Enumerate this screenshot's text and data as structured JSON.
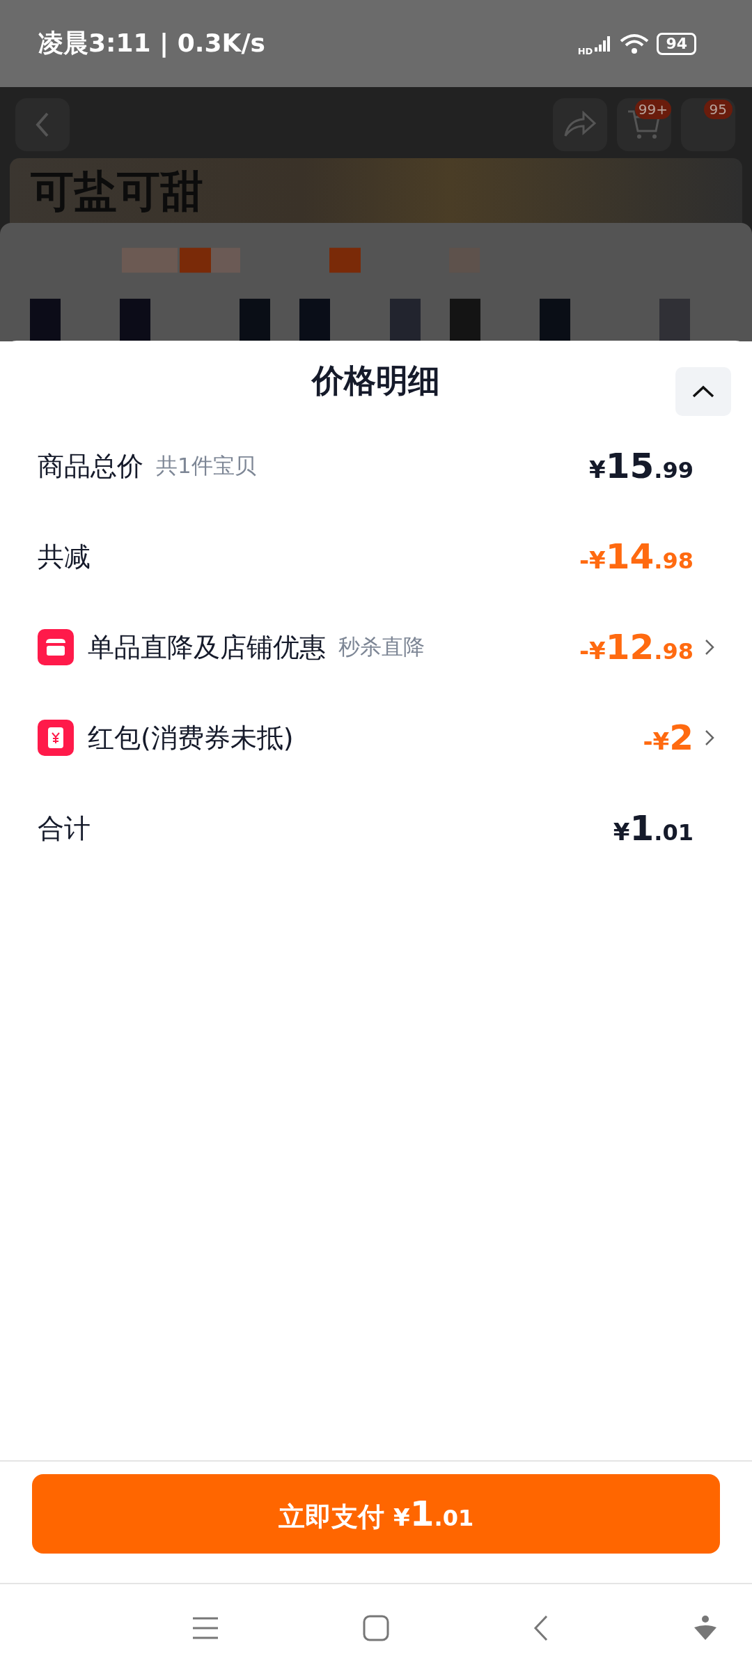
{
  "status_bar": {
    "time": "凌晨3:11 | 0.3K/s",
    "network_label": "HD",
    "battery": "94"
  },
  "background_page": {
    "cart_badge": "99+",
    "message_badge": "95",
    "banner_title": "可盐可甜"
  },
  "sheet": {
    "title": "价格明细",
    "rows": [
      {
        "kind": "plain",
        "label": "商品总价",
        "note": "共1件宝贝",
        "color": "#151a2a",
        "amount": {
          "prefix": "¥",
          "whole": "15",
          "fraction": ".99"
        },
        "has_detail": false
      },
      {
        "kind": "plain",
        "label": "共减",
        "color": "#ff6a10",
        "amount": {
          "prefix": "-¥",
          "whole": "14",
          "fraction": ".98"
        },
        "has_detail": false
      },
      {
        "kind": "shop",
        "label": "单品直降及店铺优惠",
        "note": "秒杀直降",
        "color": "#ff6a10",
        "amount": {
          "prefix": "-¥",
          "whole": "12",
          "fraction": ".98"
        },
        "has_detail": true
      },
      {
        "kind": "coupon",
        "label": "红包(消费券未抵)",
        "color": "#ff6a10",
        "amount": {
          "prefix": "-¥",
          "whole": "2"
        },
        "has_detail": true
      },
      {
        "kind": "plain",
        "label": "合计",
        "color": "#151a2a",
        "amount": {
          "prefix": "¥",
          "whole": "1",
          "fraction": ".01"
        },
        "has_detail": false
      }
    ],
    "pay_button": {
      "label": "立即支付",
      "amount": {
        "prefix": "¥",
        "whole": "1",
        "fraction": ".01"
      }
    }
  }
}
